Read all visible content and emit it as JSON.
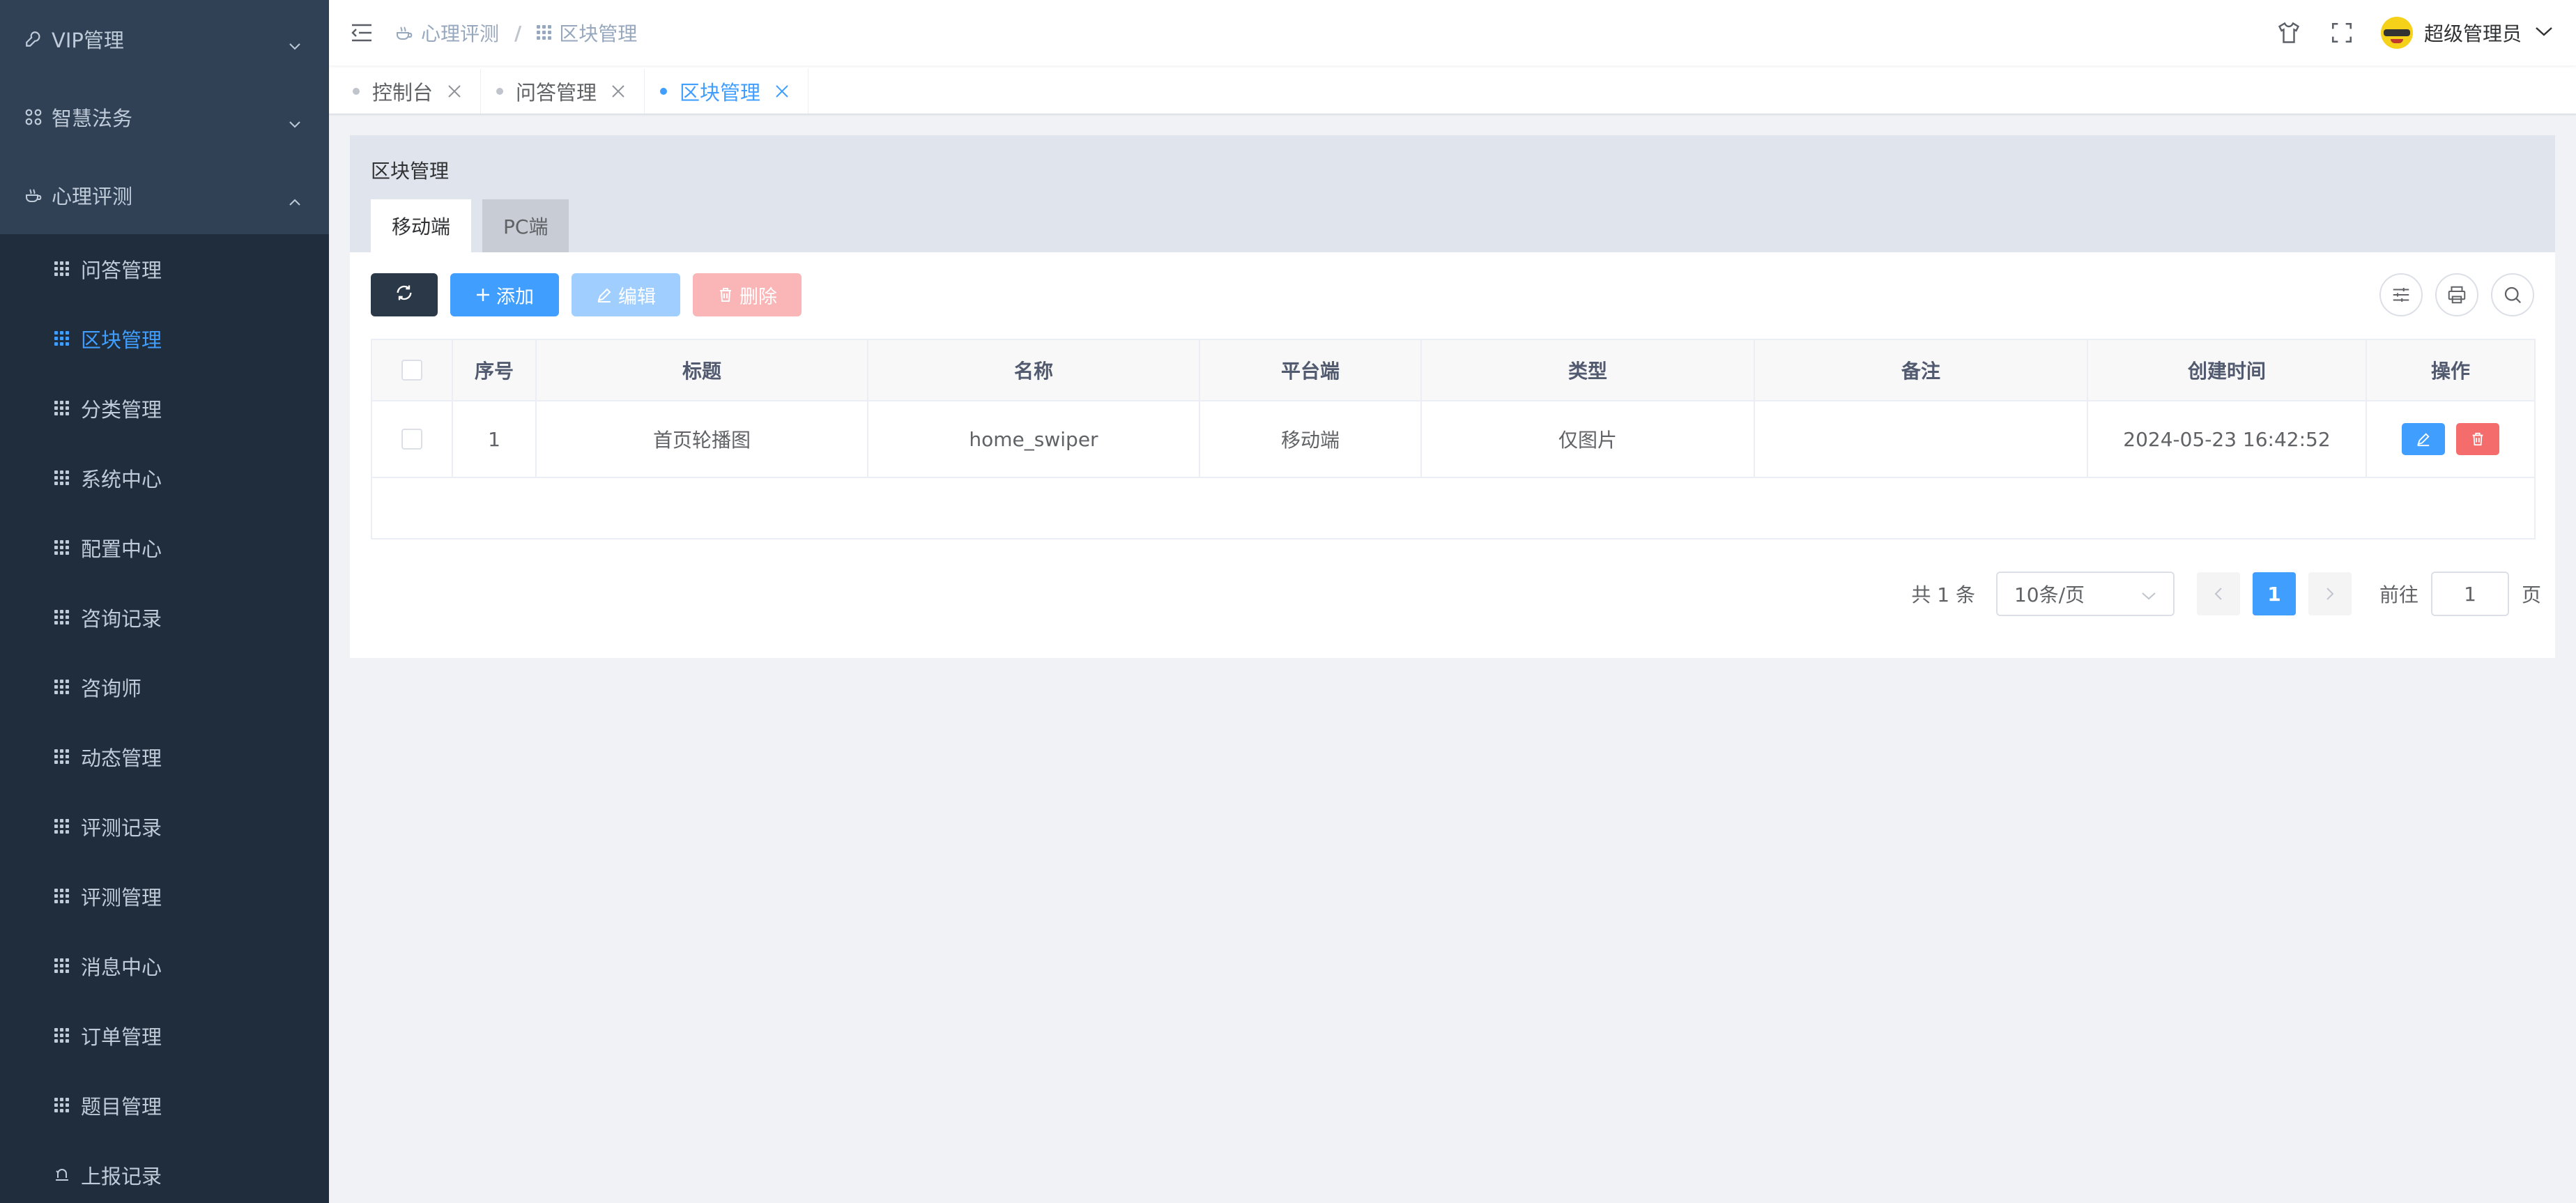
{
  "sidebar": {
    "top_menus": [
      {
        "label": "VIP管理",
        "icon": "wrench-icon",
        "expanded": false
      },
      {
        "label": "智慧法务",
        "icon": "grid-icon",
        "expanded": false
      },
      {
        "label": "心理评测",
        "icon": "tea-cup-icon",
        "expanded": true
      }
    ],
    "sub_items": [
      {
        "label": "问答管理",
        "active": false
      },
      {
        "label": "区块管理",
        "active": true
      },
      {
        "label": "分类管理",
        "active": false
      },
      {
        "label": "系统中心",
        "active": false
      },
      {
        "label": "配置中心",
        "active": false
      },
      {
        "label": "咨询记录",
        "active": false
      },
      {
        "label": "咨询师",
        "active": false
      },
      {
        "label": "动态管理",
        "active": false
      },
      {
        "label": "评测记录",
        "active": false
      },
      {
        "label": "评测管理",
        "active": false
      },
      {
        "label": "消息中心",
        "active": false
      },
      {
        "label": "订单管理",
        "active": false
      },
      {
        "label": "题目管理",
        "active": false
      },
      {
        "label": "上报记录",
        "active": false
      }
    ]
  },
  "navbar": {
    "breadcrumb": [
      "心理评测",
      "区块管理"
    ],
    "username": "超级管理员"
  },
  "tags": [
    {
      "label": "控制台",
      "active": false
    },
    {
      "label": "问答管理",
      "active": false
    },
    {
      "label": "区块管理",
      "active": true
    }
  ],
  "card": {
    "title": "区块管理",
    "tabs": [
      {
        "label": "移动端",
        "active": true
      },
      {
        "label": "PC端",
        "active": false
      }
    ]
  },
  "toolbar": {
    "add_label": "添加",
    "edit_label": "编辑",
    "delete_label": "删除"
  },
  "table": {
    "headers": [
      "序号",
      "标题",
      "名称",
      "平台端",
      "类型",
      "备注",
      "创建时间",
      "操作"
    ],
    "rows": [
      {
        "index": "1",
        "title": "首页轮播图",
        "name": "home_swiper",
        "platform": "移动端",
        "type": "仅图片",
        "remark": "",
        "created": "2024-05-23 16:42:52"
      }
    ]
  },
  "pagination": {
    "total_text": "共 1 条",
    "page_size": "10条/页",
    "current_page": "1",
    "goto_label": "前往",
    "goto_value": "1",
    "page_suffix": "页"
  },
  "colors": {
    "sidebar_bg": "#304156",
    "submenu_bg": "#1f2d3d",
    "primary": "#409eff",
    "danger": "#f56c6c"
  }
}
